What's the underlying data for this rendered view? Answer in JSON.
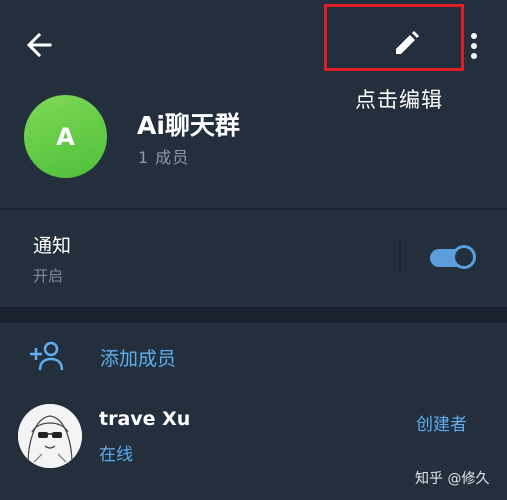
{
  "header": {
    "back_icon": "arrow-left-icon",
    "edit_icon": "pencil-icon",
    "more_icon": "more-vertical-icon",
    "annotation": "点击编辑"
  },
  "group": {
    "avatar_letter": "A",
    "name": "Ai聊天群",
    "member_count": "1 成员"
  },
  "notifications": {
    "label": "通知",
    "status": "开启",
    "enabled": true
  },
  "members": {
    "add_label": "添加成员",
    "add_icon": "add-person-icon",
    "list": [
      {
        "name": "trave Xu",
        "status": "在线",
        "role": "创建者"
      }
    ]
  },
  "watermark": "知乎 @修久",
  "colors": {
    "background": "#1c2533",
    "panel": "#242f3d",
    "accent": "#5eaef0",
    "avatar_green": "#5fc943",
    "highlight_red": "#e01e27"
  }
}
